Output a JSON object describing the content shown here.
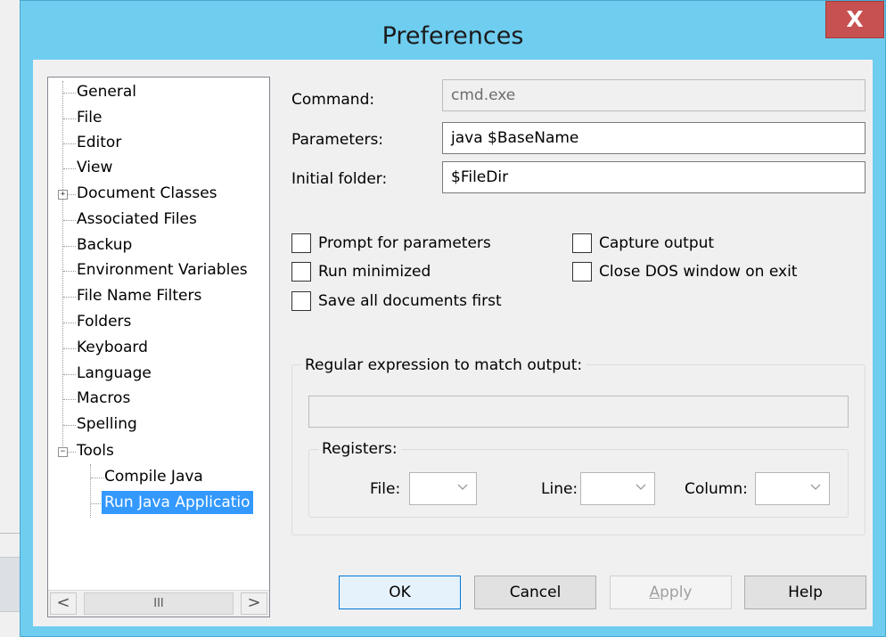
{
  "window": {
    "title": "Preferences",
    "close_label": "X"
  },
  "tree": {
    "items": [
      {
        "label": "General"
      },
      {
        "label": "File"
      },
      {
        "label": "Editor"
      },
      {
        "label": "View"
      },
      {
        "label": "Document Classes"
      },
      {
        "label": "Associated Files"
      },
      {
        "label": "Backup"
      },
      {
        "label": "Environment Variables"
      },
      {
        "label": "File Name Filters"
      },
      {
        "label": "Folders"
      },
      {
        "label": "Keyboard"
      },
      {
        "label": "Language"
      },
      {
        "label": "Macros"
      },
      {
        "label": "Spelling"
      },
      {
        "label": "Tools"
      }
    ],
    "children": [
      {
        "label": "Compile Java"
      },
      {
        "label": "Run Java Applicatio"
      }
    ],
    "expand_plus": "+",
    "expand_minus": "−",
    "scroll_left": "<",
    "scroll_thumb": "III",
    "scroll_right": ">"
  },
  "form": {
    "command_label": "Command:",
    "command_value": "cmd.exe",
    "parameters_label": "Parameters:",
    "parameters_value": "java $BaseName",
    "folder_label": "Initial folder:",
    "folder_value": "$FileDir",
    "prompt_label": "Prompt for parameters",
    "run_min_label": "Run minimized",
    "save_all_label": "Save all documents first",
    "capture_label": "Capture output",
    "close_dos_label": "Close DOS window on exit"
  },
  "regex": {
    "group_label": "Regular expression to match output:",
    "value": "",
    "registers_label": "Registers:",
    "file_label": "File:",
    "line_label": "Line:",
    "column_label": "Column:"
  },
  "buttons": {
    "ok": "OK",
    "cancel": "Cancel",
    "apply_first": "A",
    "apply_rest": "pply",
    "help": "Help"
  },
  "colors": {
    "title_bar": "#6fcdf0",
    "close_button": "#c75050",
    "selection": "#3399ff"
  }
}
